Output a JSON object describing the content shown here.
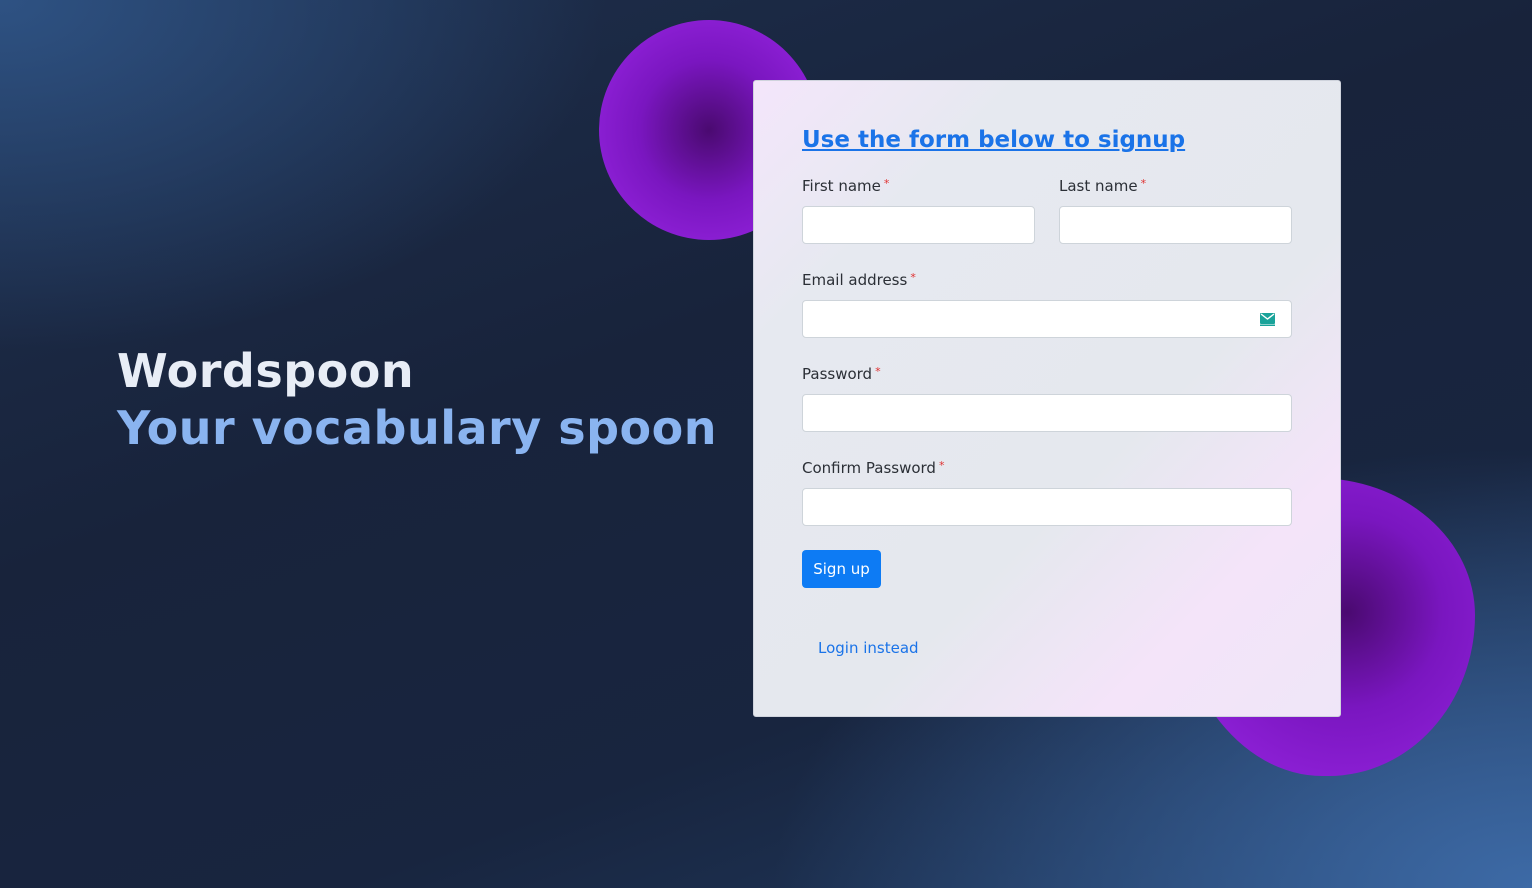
{
  "hero": {
    "title": "Wordspoon",
    "subtitle": "Your vocabulary spoon"
  },
  "form": {
    "title": "Use the form below to signup",
    "first_name_label": "First name",
    "last_name_label": "Last name",
    "email_label": "Email address",
    "password_label": "Password",
    "confirm_password_label": "Confirm Password",
    "required_marker": "*",
    "first_name_value": "",
    "last_name_value": "",
    "email_value": "",
    "password_value": "",
    "confirm_password_value": "",
    "email_icon": "mail-icon",
    "submit_label": "Sign up",
    "login_link": "Login instead"
  },
  "colors": {
    "accent": "#0d7bf4",
    "blob": "#9b27e6",
    "subtitle": "#8ab4f0"
  }
}
